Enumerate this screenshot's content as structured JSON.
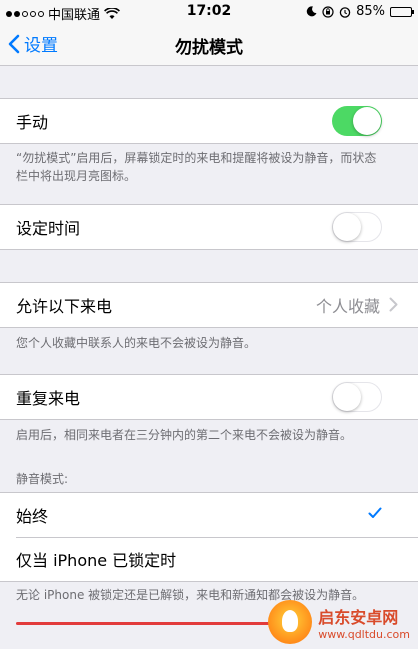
{
  "status_bar": {
    "carrier": "中国联通",
    "time": "17:02",
    "battery": "85%",
    "battery_level": 0.85,
    "icons": [
      "signal-dots-icon",
      "wifi-icon",
      "moon-icon",
      "lock-rotation-icon",
      "alarm-icon",
      "battery-icon"
    ]
  },
  "nav": {
    "back_label": "设置",
    "title": "勿扰模式"
  },
  "manual": {
    "label": "手动",
    "toggle_on": true,
    "note": "“勿扰模式”启用后，屏幕锁定时的来电和提醒将被设为静音，而状态栏中将出现月亮图标。"
  },
  "scheduled": {
    "label": "设定时间",
    "toggle_on": false
  },
  "allow_calls": {
    "label": "允许以下来电",
    "value": "个人收藏",
    "note": "您个人收藏中联系人的来电不会被设为静音。"
  },
  "repeated_calls": {
    "label": "重复来电",
    "toggle_on": false,
    "note": "启用后，相同来电者在三分钟内的第二个来电不会被设为静音。"
  },
  "silence": {
    "header": "静音模式:",
    "options": [
      {
        "label": "始终",
        "selected": true
      },
      {
        "label": "仅当 iPhone 已锁定时",
        "selected": false
      }
    ],
    "note": "无论 iPhone 被锁定还是已解锁，来电和新通知都会被设为静音。"
  },
  "watermark": {
    "name": "启东安卓网",
    "url": "www.qdltdu.com"
  },
  "colors": {
    "accent": "#007aff",
    "toggle_on": "#4cd964",
    "background": "#efeff4",
    "annotation_underline": "#e23b3b"
  }
}
